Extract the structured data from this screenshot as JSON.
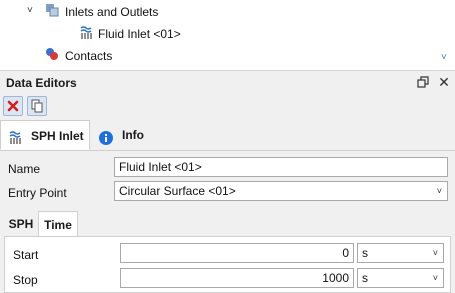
{
  "tree": {
    "inlets_label": "Inlets and Outlets",
    "fluid_inlet_label": "Fluid Inlet <01>",
    "contacts_label": "Contacts"
  },
  "panel": {
    "title": "Data Editors"
  },
  "tabs": [
    {
      "label": "SPH Inlet"
    },
    {
      "label": "Info"
    }
  ],
  "form": {
    "name_label": "Name",
    "name_value": "Fluid Inlet <01>",
    "entry_point_label": "Entry Point",
    "entry_point_value": "Circular Surface <01>"
  },
  "subtabs": [
    {
      "label": "SPH"
    },
    {
      "label": "Time"
    }
  ],
  "time": {
    "start_label": "Start",
    "start_value": "0",
    "start_unit": "s",
    "stop_label": "Stop",
    "stop_value": "1000",
    "stop_unit": "s"
  },
  "colors": {
    "delete_red": "#d32020",
    "info_blue": "#1e6fd9",
    "accent_blue": "#2a7ad2"
  }
}
